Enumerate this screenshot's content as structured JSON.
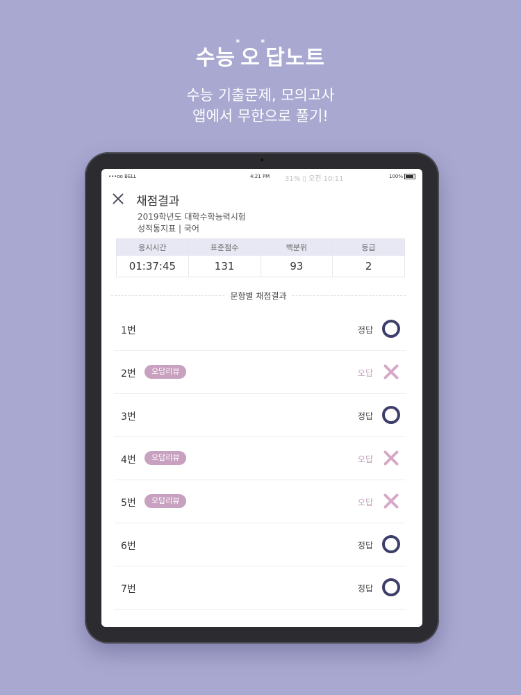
{
  "promo": {
    "brand_part1": "수능",
    "brand_star1": "*",
    "brand_part2": "오",
    "brand_star2": "*",
    "brand_part3": "답노트",
    "tagline_line1": "수능 기출문제, 모의고사",
    "tagline_line2": "앱에서 무한으로 풀기!"
  },
  "statusbar": {
    "carrier": "•••oo BELL",
    "time": "4:21 PM",
    "overlay": "31% ▯ 오전 10:11",
    "battery": "100%"
  },
  "header": {
    "title": "채점결과",
    "exam_name": "2019학년도 대학수학능력시험",
    "report": "성적통지표  |  국어"
  },
  "summary": {
    "headers": [
      "응시시간",
      "표준점수",
      "백분위",
      "등급"
    ],
    "values": [
      "01:37:45",
      "131",
      "93",
      "2"
    ]
  },
  "section_title": "문항별 채점결과",
  "questions": [
    {
      "label": "1번",
      "result": "정답",
      "review": ""
    },
    {
      "label": "2번",
      "result": "오답",
      "review": "오답리뷰"
    },
    {
      "label": "3번",
      "result": "정답",
      "review": ""
    },
    {
      "label": "4번",
      "result": "오답",
      "review": "오답리뷰"
    },
    {
      "label": "5번",
      "result": "오답",
      "review": "오답리뷰"
    },
    {
      "label": "6번",
      "result": "정답",
      "review": ""
    },
    {
      "label": "7번",
      "result": "정답",
      "review": ""
    }
  ],
  "colors": {
    "background": "#a8a8d0",
    "correct_mark": "#3e3e6a",
    "wrong_mark": "#d6a8c8",
    "review_badge": "#c8a0c0",
    "table_header": "#e8e8f4"
  }
}
